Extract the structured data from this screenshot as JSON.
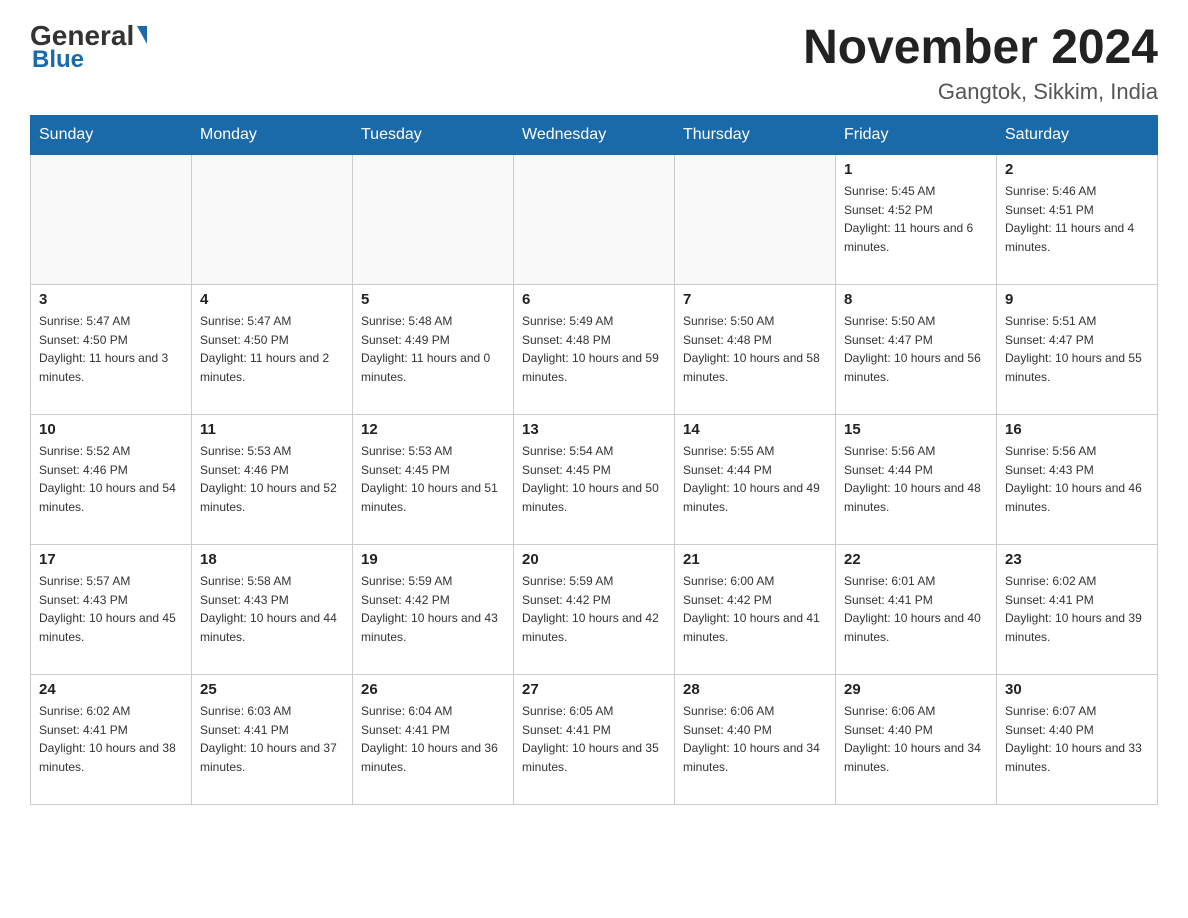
{
  "header": {
    "logo_general": "General",
    "logo_blue": "Blue",
    "month_year": "November 2024",
    "location": "Gangtok, Sikkim, India"
  },
  "weekdays": [
    "Sunday",
    "Monday",
    "Tuesday",
    "Wednesday",
    "Thursday",
    "Friday",
    "Saturday"
  ],
  "weeks": [
    [
      {
        "day": "",
        "sunrise": "",
        "sunset": "",
        "daylight": ""
      },
      {
        "day": "",
        "sunrise": "",
        "sunset": "",
        "daylight": ""
      },
      {
        "day": "",
        "sunrise": "",
        "sunset": "",
        "daylight": ""
      },
      {
        "day": "",
        "sunrise": "",
        "sunset": "",
        "daylight": ""
      },
      {
        "day": "",
        "sunrise": "",
        "sunset": "",
        "daylight": ""
      },
      {
        "day": "1",
        "sunrise": "Sunrise: 5:45 AM",
        "sunset": "Sunset: 4:52 PM",
        "daylight": "Daylight: 11 hours and 6 minutes."
      },
      {
        "day": "2",
        "sunrise": "Sunrise: 5:46 AM",
        "sunset": "Sunset: 4:51 PM",
        "daylight": "Daylight: 11 hours and 4 minutes."
      }
    ],
    [
      {
        "day": "3",
        "sunrise": "Sunrise: 5:47 AM",
        "sunset": "Sunset: 4:50 PM",
        "daylight": "Daylight: 11 hours and 3 minutes."
      },
      {
        "day": "4",
        "sunrise": "Sunrise: 5:47 AM",
        "sunset": "Sunset: 4:50 PM",
        "daylight": "Daylight: 11 hours and 2 minutes."
      },
      {
        "day": "5",
        "sunrise": "Sunrise: 5:48 AM",
        "sunset": "Sunset: 4:49 PM",
        "daylight": "Daylight: 11 hours and 0 minutes."
      },
      {
        "day": "6",
        "sunrise": "Sunrise: 5:49 AM",
        "sunset": "Sunset: 4:48 PM",
        "daylight": "Daylight: 10 hours and 59 minutes."
      },
      {
        "day": "7",
        "sunrise": "Sunrise: 5:50 AM",
        "sunset": "Sunset: 4:48 PM",
        "daylight": "Daylight: 10 hours and 58 minutes."
      },
      {
        "day": "8",
        "sunrise": "Sunrise: 5:50 AM",
        "sunset": "Sunset: 4:47 PM",
        "daylight": "Daylight: 10 hours and 56 minutes."
      },
      {
        "day": "9",
        "sunrise": "Sunrise: 5:51 AM",
        "sunset": "Sunset: 4:47 PM",
        "daylight": "Daylight: 10 hours and 55 minutes."
      }
    ],
    [
      {
        "day": "10",
        "sunrise": "Sunrise: 5:52 AM",
        "sunset": "Sunset: 4:46 PM",
        "daylight": "Daylight: 10 hours and 54 minutes."
      },
      {
        "day": "11",
        "sunrise": "Sunrise: 5:53 AM",
        "sunset": "Sunset: 4:46 PM",
        "daylight": "Daylight: 10 hours and 52 minutes."
      },
      {
        "day": "12",
        "sunrise": "Sunrise: 5:53 AM",
        "sunset": "Sunset: 4:45 PM",
        "daylight": "Daylight: 10 hours and 51 minutes."
      },
      {
        "day": "13",
        "sunrise": "Sunrise: 5:54 AM",
        "sunset": "Sunset: 4:45 PM",
        "daylight": "Daylight: 10 hours and 50 minutes."
      },
      {
        "day": "14",
        "sunrise": "Sunrise: 5:55 AM",
        "sunset": "Sunset: 4:44 PM",
        "daylight": "Daylight: 10 hours and 49 minutes."
      },
      {
        "day": "15",
        "sunrise": "Sunrise: 5:56 AM",
        "sunset": "Sunset: 4:44 PM",
        "daylight": "Daylight: 10 hours and 48 minutes."
      },
      {
        "day": "16",
        "sunrise": "Sunrise: 5:56 AM",
        "sunset": "Sunset: 4:43 PM",
        "daylight": "Daylight: 10 hours and 46 minutes."
      }
    ],
    [
      {
        "day": "17",
        "sunrise": "Sunrise: 5:57 AM",
        "sunset": "Sunset: 4:43 PM",
        "daylight": "Daylight: 10 hours and 45 minutes."
      },
      {
        "day": "18",
        "sunrise": "Sunrise: 5:58 AM",
        "sunset": "Sunset: 4:43 PM",
        "daylight": "Daylight: 10 hours and 44 minutes."
      },
      {
        "day": "19",
        "sunrise": "Sunrise: 5:59 AM",
        "sunset": "Sunset: 4:42 PM",
        "daylight": "Daylight: 10 hours and 43 minutes."
      },
      {
        "day": "20",
        "sunrise": "Sunrise: 5:59 AM",
        "sunset": "Sunset: 4:42 PM",
        "daylight": "Daylight: 10 hours and 42 minutes."
      },
      {
        "day": "21",
        "sunrise": "Sunrise: 6:00 AM",
        "sunset": "Sunset: 4:42 PM",
        "daylight": "Daylight: 10 hours and 41 minutes."
      },
      {
        "day": "22",
        "sunrise": "Sunrise: 6:01 AM",
        "sunset": "Sunset: 4:41 PM",
        "daylight": "Daylight: 10 hours and 40 minutes."
      },
      {
        "day": "23",
        "sunrise": "Sunrise: 6:02 AM",
        "sunset": "Sunset: 4:41 PM",
        "daylight": "Daylight: 10 hours and 39 minutes."
      }
    ],
    [
      {
        "day": "24",
        "sunrise": "Sunrise: 6:02 AM",
        "sunset": "Sunset: 4:41 PM",
        "daylight": "Daylight: 10 hours and 38 minutes."
      },
      {
        "day": "25",
        "sunrise": "Sunrise: 6:03 AM",
        "sunset": "Sunset: 4:41 PM",
        "daylight": "Daylight: 10 hours and 37 minutes."
      },
      {
        "day": "26",
        "sunrise": "Sunrise: 6:04 AM",
        "sunset": "Sunset: 4:41 PM",
        "daylight": "Daylight: 10 hours and 36 minutes."
      },
      {
        "day": "27",
        "sunrise": "Sunrise: 6:05 AM",
        "sunset": "Sunset: 4:41 PM",
        "daylight": "Daylight: 10 hours and 35 minutes."
      },
      {
        "day": "28",
        "sunrise": "Sunrise: 6:06 AM",
        "sunset": "Sunset: 4:40 PM",
        "daylight": "Daylight: 10 hours and 34 minutes."
      },
      {
        "day": "29",
        "sunrise": "Sunrise: 6:06 AM",
        "sunset": "Sunset: 4:40 PM",
        "daylight": "Daylight: 10 hours and 34 minutes."
      },
      {
        "day": "30",
        "sunrise": "Sunrise: 6:07 AM",
        "sunset": "Sunset: 4:40 PM",
        "daylight": "Daylight: 10 hours and 33 minutes."
      }
    ]
  ]
}
